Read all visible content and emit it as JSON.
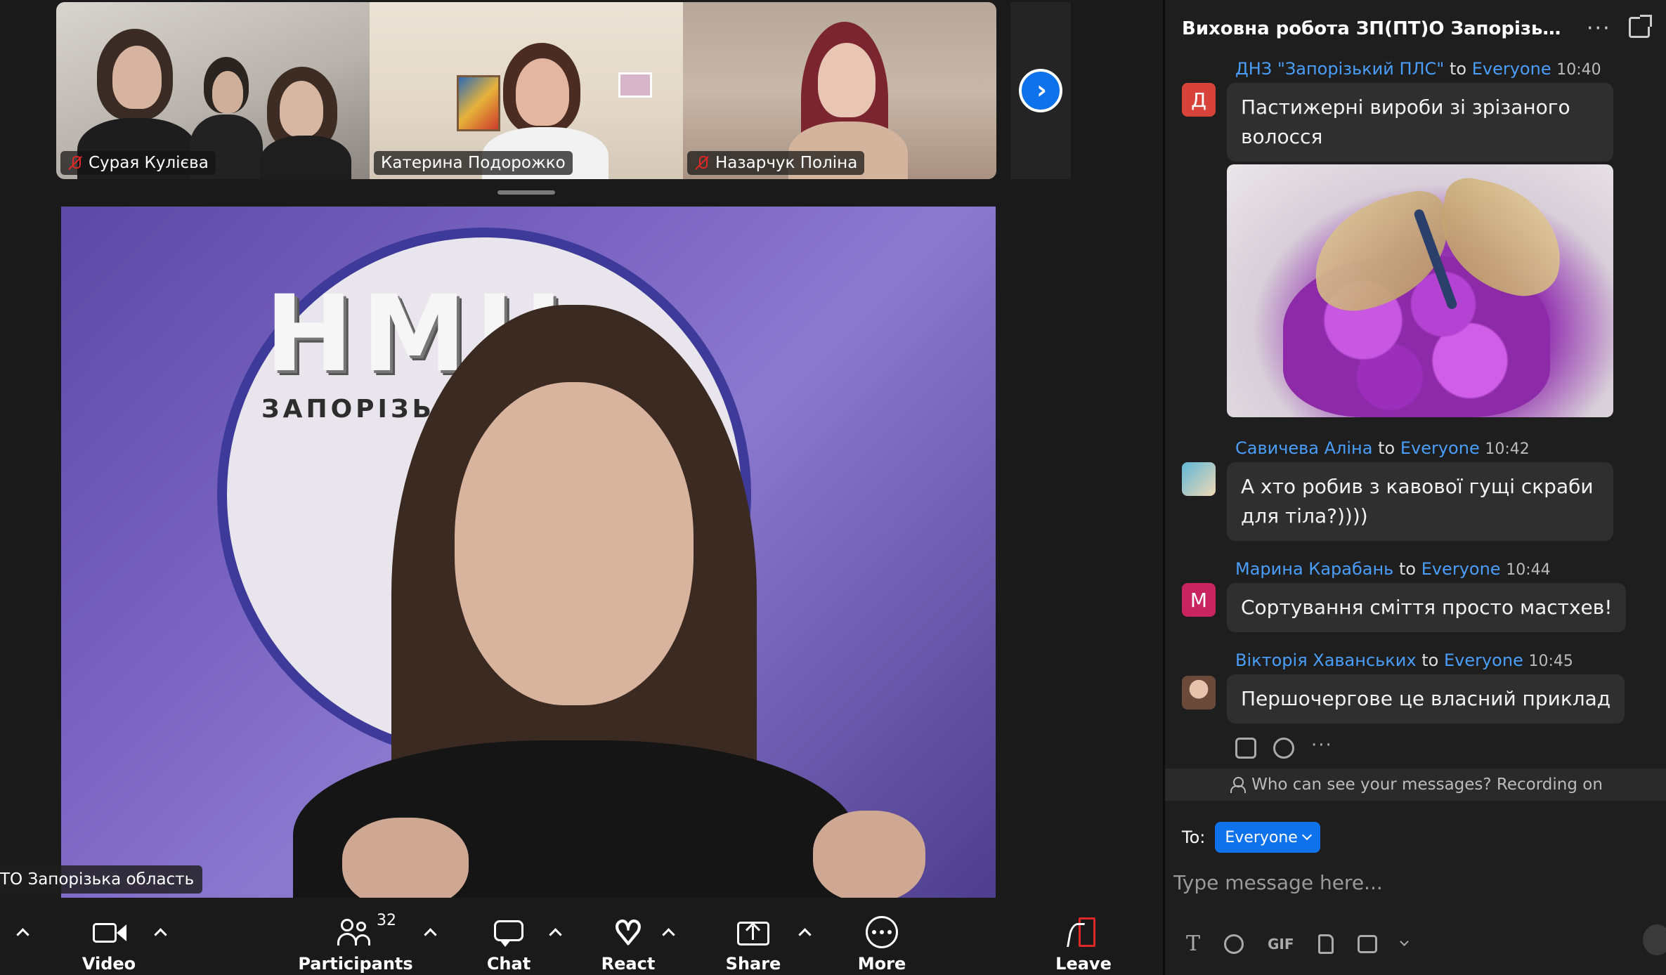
{
  "thumbnails": [
    {
      "name": "Сурая Кулієва",
      "muted": true
    },
    {
      "name": "Катерина Подорожко",
      "muted": false
    },
    {
      "name": "Назарчук Поліна",
      "muted": true
    }
  ],
  "main_video": {
    "banner_logo_text": "НМЦ",
    "banner_sub_text": "ЗАПОРІЗЬКА",
    "location_label": "ТО Запорізька область"
  },
  "toolbar": {
    "video_label": "Video",
    "participants_label": "Participants",
    "participants_count": "32",
    "chat_label": "Chat",
    "react_label": "React",
    "share_label": "Share",
    "more_label": "More",
    "leave_label": "Leave"
  },
  "chat": {
    "title": "Виховна робота ЗП(ПТ)О Запорізької обл...",
    "messages": [
      {
        "sender": "ДНЗ \"Запорізький ПЛС\"",
        "to_word": "to",
        "to": "Everyone",
        "time": "10:40",
        "avatar_letter": "Д",
        "avatar_color": "#d7433a",
        "text": "Пастижерні вироби зі зрізаного волосся"
      },
      {
        "sender": "Савичева Аліна",
        "to_word": "to",
        "to": "Everyone",
        "time": "10:42",
        "text": "А хто робив з кавової гущі скраби для тіла?))))"
      },
      {
        "sender": "Марина Карабань",
        "to_word": "to",
        "to": "Everyone",
        "time": "10:44",
        "avatar_letter": "М",
        "avatar_color": "#c8255e",
        "text": "Сортування сміття просто мастхев!"
      },
      {
        "sender": "Вікторія Хаванських",
        "to_word": "to",
        "to": "Everyone",
        "time": "10:45",
        "text": "Першочергове це власний приклад"
      }
    ],
    "privacy_notice": "Who can see your messages? Recording on",
    "to_label": "To:",
    "recipient": "Everyone",
    "input_placeholder": "Type message here...",
    "gif_label": "GIF",
    "format_label": "T"
  },
  "colors": {
    "accent": "#0e72ed",
    "link": "#4a9df8",
    "mic_off": "#e02828",
    "panel_bg": "#1e1e1e",
    "bubble_bg": "#2f2f2f"
  }
}
